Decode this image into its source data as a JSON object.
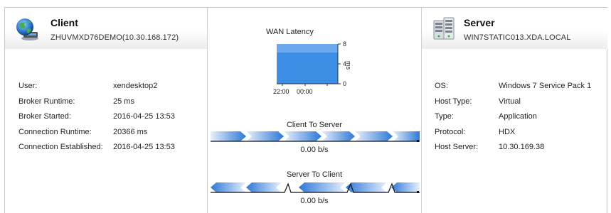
{
  "client": {
    "title": "Client",
    "subtitle": "ZHUVMXD76DEMO(10.30.168.172)",
    "icon": "globe-computer-icon",
    "fields": [
      {
        "label": "User:",
        "value": "xendesktop2"
      },
      {
        "label": "Broker Runtime:",
        "value": "25 ms"
      },
      {
        "label": "Broker Started:",
        "value": "2016-04-25 13:53"
      },
      {
        "label": "Connection Runtime:",
        "value": "20366 ms"
      },
      {
        "label": "Connection Established:",
        "value": "2016-04-25 13:53"
      }
    ]
  },
  "server": {
    "title": "Server",
    "subtitle": "WIN7STATIC013.XDA.LOCAL",
    "icon": "server-rack-icon",
    "fields": [
      {
        "label": "OS:",
        "value": "Windows 7 Service Pack 1"
      },
      {
        "label": "Host Type:",
        "value": "Virtual"
      },
      {
        "label": "Type:",
        "value": "Application"
      },
      {
        "label": "Protocol:",
        "value": "HDX"
      },
      {
        "label": "Host Server:",
        "value": "10.30.169.38"
      }
    ]
  },
  "wan": {
    "title": "WAN Latency",
    "unit": "ms",
    "y_ticks": [
      "8",
      "4",
      "0"
    ],
    "x_ticks": [
      "22:00",
      "00:00"
    ]
  },
  "client_to_server": {
    "title": "Client To Server",
    "value": "0.00 b/s"
  },
  "server_to_client": {
    "title": "Server To Client",
    "value": "0.00 b/s"
  },
  "colors": {
    "accent": "#3d8fe6",
    "light": "#9fc4ee",
    "header_grad": "#ececec"
  }
}
